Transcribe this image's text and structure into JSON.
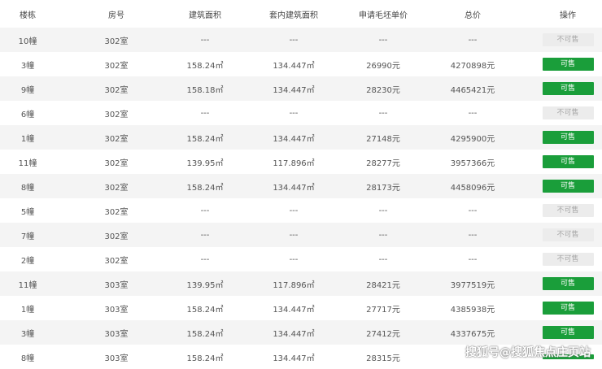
{
  "headers": [
    "楼栋",
    "房号",
    "建筑面积",
    "套内建筑面积",
    "申请毛坯单价",
    "总价",
    "操作"
  ],
  "rows": [
    {
      "building": "10幢",
      "room": "302室",
      "area": "---",
      "inner_area": "---",
      "unit_price": "---",
      "total": "---",
      "status": "不可售",
      "sale": false
    },
    {
      "building": "3幢",
      "room": "302室",
      "area": "158.24㎡",
      "inner_area": "134.447㎡",
      "unit_price": "26990元",
      "total": "4270898元",
      "status": "可售",
      "sale": true
    },
    {
      "building": "9幢",
      "room": "302室",
      "area": "158.18㎡",
      "inner_area": "134.447㎡",
      "unit_price": "28230元",
      "total": "4465421元",
      "status": "可售",
      "sale": true
    },
    {
      "building": "6幢",
      "room": "302室",
      "area": "---",
      "inner_area": "---",
      "unit_price": "---",
      "total": "---",
      "status": "不可售",
      "sale": false
    },
    {
      "building": "1幢",
      "room": "302室",
      "area": "158.24㎡",
      "inner_area": "134.447㎡",
      "unit_price": "27148元",
      "total": "4295900元",
      "status": "可售",
      "sale": true
    },
    {
      "building": "11幢",
      "room": "302室",
      "area": "139.95㎡",
      "inner_area": "117.896㎡",
      "unit_price": "28277元",
      "total": "3957366元",
      "status": "可售",
      "sale": true
    },
    {
      "building": "8幢",
      "room": "302室",
      "area": "158.24㎡",
      "inner_area": "134.447㎡",
      "unit_price": "28173元",
      "total": "4458096元",
      "status": "可售",
      "sale": true
    },
    {
      "building": "5幢",
      "room": "302室",
      "area": "---",
      "inner_area": "---",
      "unit_price": "---",
      "total": "---",
      "status": "不可售",
      "sale": false
    },
    {
      "building": "7幢",
      "room": "302室",
      "area": "---",
      "inner_area": "---",
      "unit_price": "---",
      "total": "---",
      "status": "不可售",
      "sale": false
    },
    {
      "building": "2幢",
      "room": "302室",
      "area": "---",
      "inner_area": "---",
      "unit_price": "---",
      "total": "---",
      "status": "不可售",
      "sale": false
    },
    {
      "building": "11幢",
      "room": "303室",
      "area": "139.95㎡",
      "inner_area": "117.896㎡",
      "unit_price": "28421元",
      "total": "3977519元",
      "status": "可售",
      "sale": true
    },
    {
      "building": "1幢",
      "room": "303室",
      "area": "158.24㎡",
      "inner_area": "134.447㎡",
      "unit_price": "27717元",
      "total": "4385938元",
      "status": "可售",
      "sale": true
    },
    {
      "building": "3幢",
      "room": "303室",
      "area": "158.24㎡",
      "inner_area": "134.447㎡",
      "unit_price": "27412元",
      "total": "4337675元",
      "status": "可售",
      "sale": true
    },
    {
      "building": "8幢",
      "room": "303室",
      "area": "158.24㎡",
      "inner_area": "134.447㎡",
      "unit_price": "28315元",
      "total": "",
      "status": "",
      "sale": true
    }
  ],
  "watermark": "搜狐号@搜狐焦点庄页站",
  "colors": {
    "sale_button": "#1a9e3a",
    "nosale_button": "#ececec",
    "stripe": "#f4f4f4"
  }
}
